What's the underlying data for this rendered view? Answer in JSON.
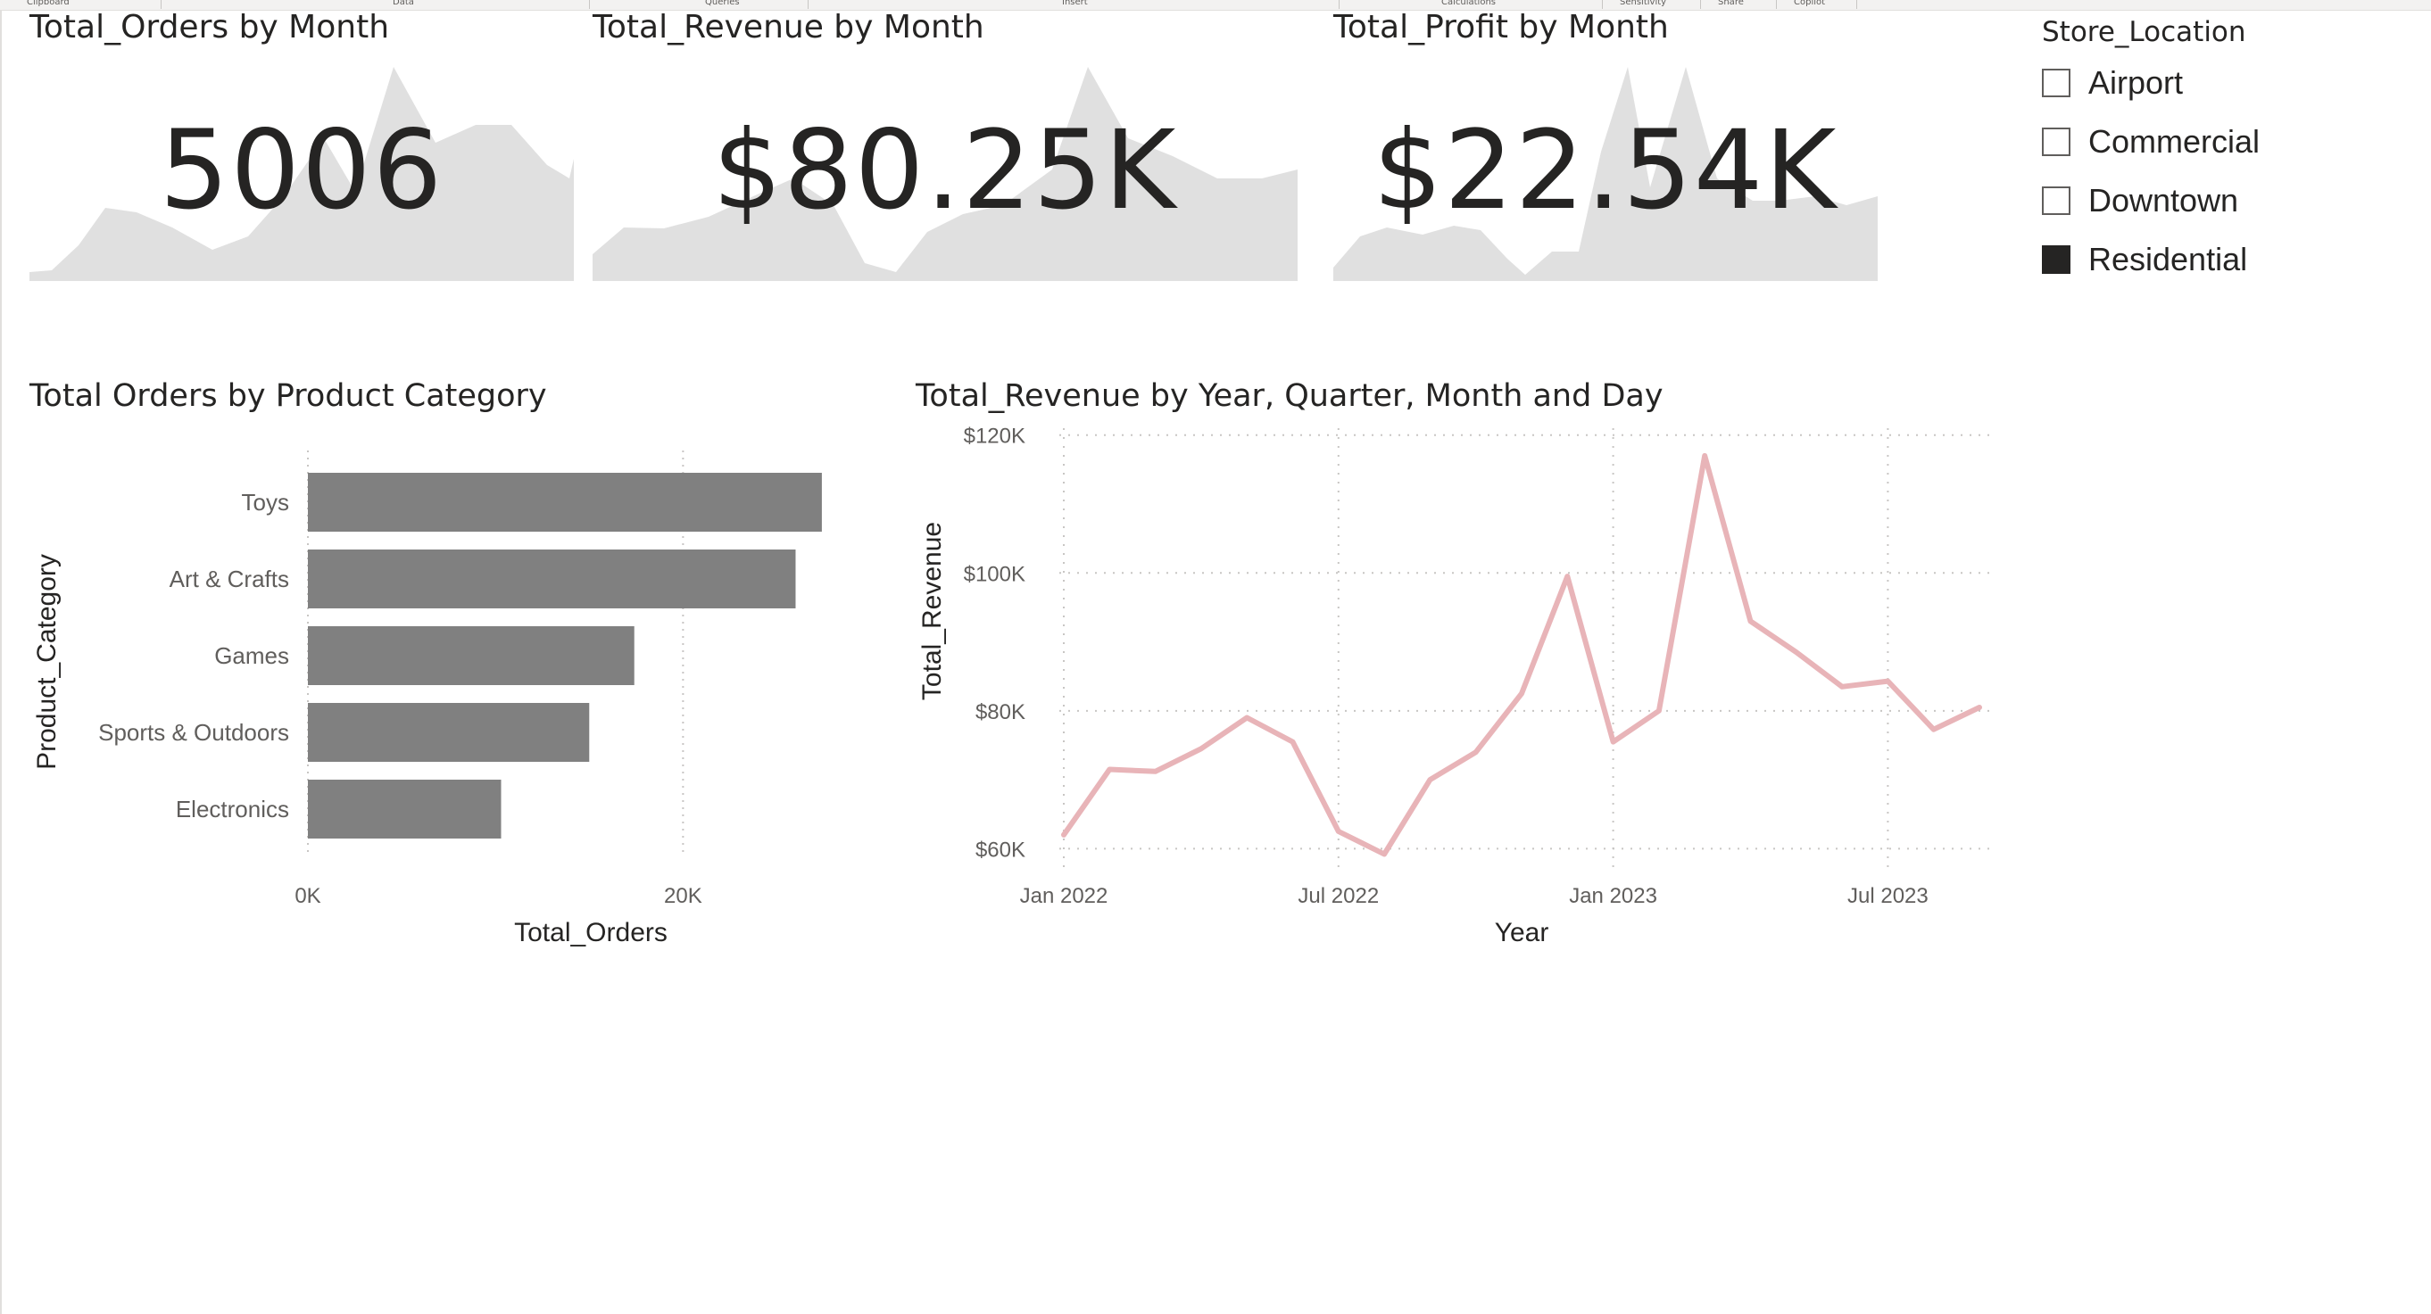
{
  "ribbon": {
    "groups": [
      "Clipboard",
      "Data",
      "Queries",
      "Insert",
      "Calculations",
      "Sensitivity",
      "Share",
      "Copilot"
    ]
  },
  "cards": [
    {
      "title": "Total_Orders by Month",
      "value": "5006"
    },
    {
      "title": "Total_Revenue by Month",
      "value": "$80.25K"
    },
    {
      "title": "Total_Profit by Month",
      "value": "$22.54K"
    }
  ],
  "slicer": {
    "title": "Store_Location",
    "options": [
      {
        "label": "Airport",
        "checked": false
      },
      {
        "label": "Commercial",
        "checked": false
      },
      {
        "label": "Downtown",
        "checked": false
      },
      {
        "label": "Residential",
        "checked": true
      }
    ]
  },
  "bar_visual": {
    "title": "Total Orders by Product Category"
  },
  "line_visual": {
    "title": "Total_Revenue by Year, Quarter, Month and Day"
  },
  "chart_data": [
    {
      "type": "bar",
      "orientation": "horizontal",
      "title": "Total Orders by Product Category",
      "xlabel": "Total_Orders",
      "ylabel": "Product_Category",
      "categories": [
        "Toys",
        "Art & Crafts",
        "Games",
        "Sports & Outdoors",
        "Electronics"
      ],
      "values": [
        27400,
        26000,
        17400,
        15000,
        10300
      ],
      "xlim": [
        0,
        27500
      ],
      "xticks": [
        "0K",
        "20K"
      ],
      "xtick_values": [
        0,
        20000
      ],
      "bar_color": "#808080",
      "grid": true
    },
    {
      "type": "line",
      "title": "Total_Revenue by Year, Quarter, Month and Day",
      "xlabel": "Year",
      "ylabel": "Total_Revenue",
      "x": [
        "2022-01",
        "2022-02",
        "2022-03",
        "2022-04",
        "2022-05",
        "2022-06",
        "2022-07",
        "2022-08",
        "2022-09",
        "2022-10",
        "2022-11",
        "2022-12",
        "2023-01",
        "2023-02",
        "2023-03",
        "2023-04",
        "2023-05",
        "2023-06",
        "2023-07",
        "2023-08",
        "2023-09"
      ],
      "values": [
        62000,
        71500,
        71200,
        74500,
        79000,
        75500,
        62500,
        59200,
        70000,
        74000,
        82500,
        99500,
        75500,
        80000,
        117000,
        93000,
        88500,
        83500,
        84300,
        77300,
        80500
      ],
      "ylim": [
        55000,
        121000
      ],
      "yticks": [
        "$60K",
        "$80K",
        "$100K",
        "$120K"
      ],
      "ytick_values": [
        60000,
        80000,
        100000,
        120000
      ],
      "xticks": [
        "Jan 2022",
        "Jul 2022",
        "Jan 2023",
        "Jul 2023"
      ],
      "xtick_values": [
        "2022-01",
        "2022-07",
        "2023-01",
        "2023-07"
      ],
      "line_color": "#e8b4b8",
      "grid": true
    }
  ]
}
